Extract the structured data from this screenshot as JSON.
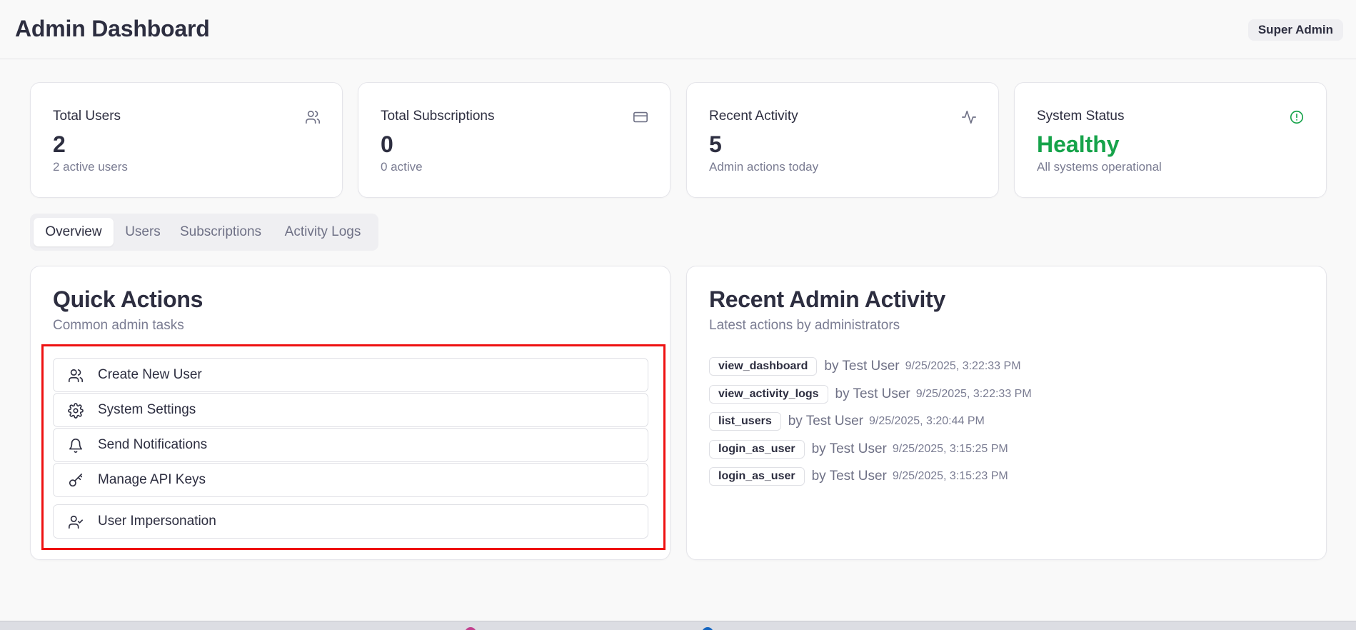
{
  "header": {
    "title": "Admin Dashboard",
    "role_badge": "Super Admin"
  },
  "stats": [
    {
      "title": "Total Users",
      "value": "2",
      "sub": "2 active users",
      "icon": "users-icon"
    },
    {
      "title": "Total Subscriptions",
      "value": "0",
      "sub": "0 active",
      "icon": "credit-card-icon"
    },
    {
      "title": "Recent Activity",
      "value": "5",
      "sub": "Admin actions today",
      "icon": "activity-icon"
    },
    {
      "title": "System Status",
      "value": "Healthy",
      "sub": "All systems operational",
      "icon": "alert-circle-icon",
      "value_color": "#16a34a"
    }
  ],
  "tabs": [
    {
      "label": "Overview",
      "active": true
    },
    {
      "label": "Users",
      "active": false
    },
    {
      "label": "Subscriptions",
      "active": false
    },
    {
      "label": "Activity Logs",
      "active": false
    }
  ],
  "quick_actions": {
    "title": "Quick Actions",
    "subtitle": "Common admin tasks",
    "items": [
      {
        "label": "Create New User",
        "icon": "users-icon"
      },
      {
        "label": "System Settings",
        "icon": "gear-icon"
      },
      {
        "label": "Send Notifications",
        "icon": "bell-icon"
      },
      {
        "label": "Manage API Keys",
        "icon": "key-icon"
      },
      {
        "label": "User Impersonation",
        "icon": "user-check-icon"
      }
    ]
  },
  "recent_activity": {
    "title": "Recent Admin Activity",
    "subtitle": "Latest actions by administrators",
    "items": [
      {
        "action": "view_dashboard",
        "by": "by Test User",
        "time": "9/25/2025, 3:22:33 PM"
      },
      {
        "action": "view_activity_logs",
        "by": "by Test User",
        "time": "9/25/2025, 3:22:33 PM"
      },
      {
        "action": "list_users",
        "by": "by Test User",
        "time": "9/25/2025, 3:20:44 PM"
      },
      {
        "action": "login_as_user",
        "by": "by Test User",
        "time": "9/25/2025, 3:15:25 PM"
      },
      {
        "action": "login_as_user",
        "by": "by Test User",
        "time": "9/25/2025, 3:15:23 PM"
      }
    ]
  },
  "colors": {
    "accent_success": "#16a34a",
    "highlight": "#ee1111"
  }
}
